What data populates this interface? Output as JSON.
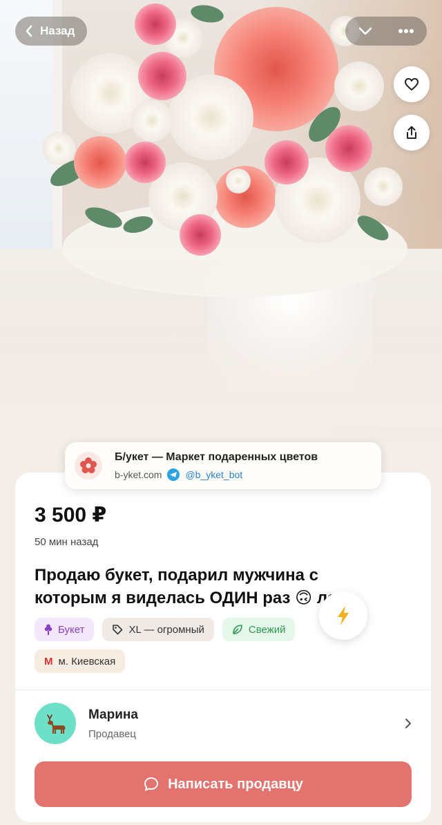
{
  "nav": {
    "back_label": "Назад",
    "icons": [
      "chevron-left-icon",
      "chevron-down-icon",
      "more-dots-icon",
      "heart-icon",
      "share-icon"
    ]
  },
  "banner": {
    "title": "Б/укет — Маркет подаренных цветов",
    "site": "b-yket.com",
    "telegram": "@b_yket_bot"
  },
  "listing": {
    "price": "3 500 ₽",
    "posted": "50 мин назад",
    "title": "Продаю букет, подарил мужчина с которым я виделась ОДИН раз 🙃 лс",
    "tags": [
      {
        "label": "Букет",
        "icon": "bouquet-icon"
      },
      {
        "label": "XL — огромный",
        "icon": "tag-icon"
      },
      {
        "label": "Свежий",
        "icon": "leaf-icon"
      }
    ],
    "metro": {
      "symbol": "М",
      "label": "м. Киевская"
    }
  },
  "seller": {
    "name": "Марина",
    "role": "Продавец",
    "avatar_icon": "deer-icon"
  },
  "cta": {
    "label": "Написать продавцу",
    "icon": "chat-bubble-icon"
  },
  "colors": {
    "accent": "#e3736f",
    "background": "#f4eee9",
    "tag_purple": "#8a3fc8",
    "tag_green": "#2d9a4f",
    "metro_red": "#d8322f",
    "avatar": "#6fe0c8"
  }
}
